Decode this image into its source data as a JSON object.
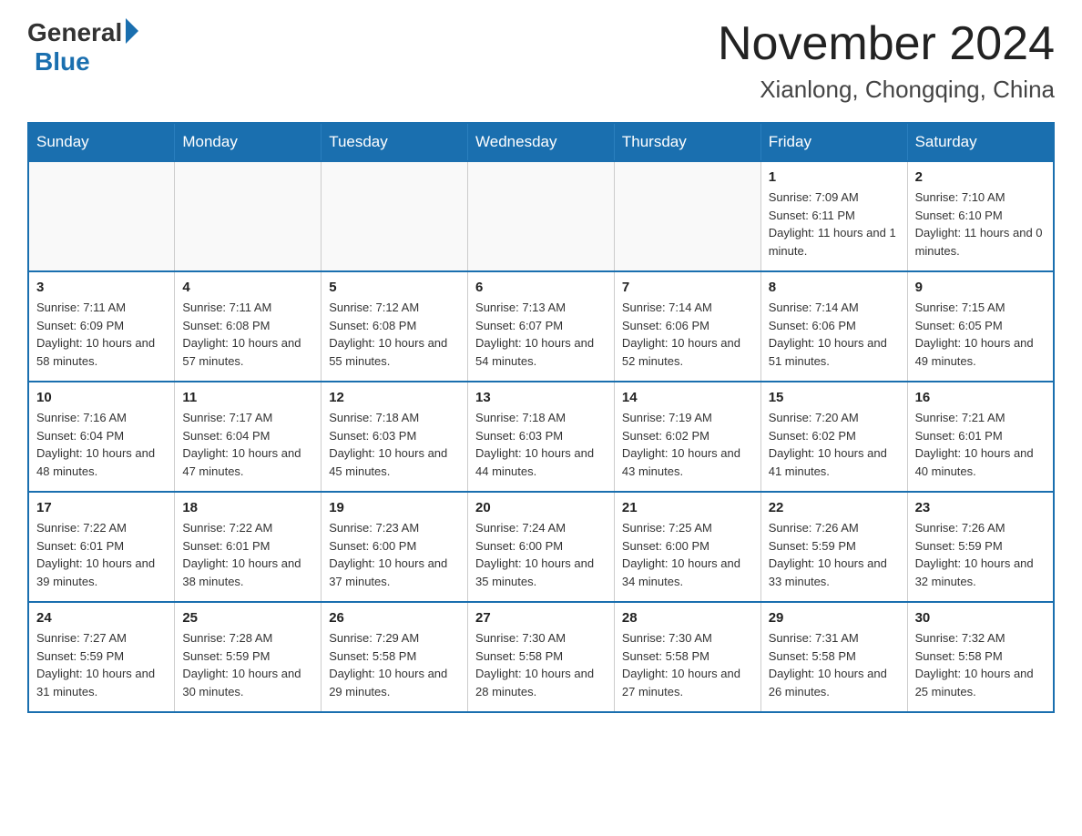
{
  "logo": {
    "general": "General",
    "blue": "Blue"
  },
  "header": {
    "month": "November 2024",
    "location": "Xianlong, Chongqing, China"
  },
  "days_of_week": [
    "Sunday",
    "Monday",
    "Tuesday",
    "Wednesday",
    "Thursday",
    "Friday",
    "Saturday"
  ],
  "weeks": [
    [
      {
        "day": "",
        "info": ""
      },
      {
        "day": "",
        "info": ""
      },
      {
        "day": "",
        "info": ""
      },
      {
        "day": "",
        "info": ""
      },
      {
        "day": "",
        "info": ""
      },
      {
        "day": "1",
        "info": "Sunrise: 7:09 AM\nSunset: 6:11 PM\nDaylight: 11 hours and 1 minute."
      },
      {
        "day": "2",
        "info": "Sunrise: 7:10 AM\nSunset: 6:10 PM\nDaylight: 11 hours and 0 minutes."
      }
    ],
    [
      {
        "day": "3",
        "info": "Sunrise: 7:11 AM\nSunset: 6:09 PM\nDaylight: 10 hours and 58 minutes."
      },
      {
        "day": "4",
        "info": "Sunrise: 7:11 AM\nSunset: 6:08 PM\nDaylight: 10 hours and 57 minutes."
      },
      {
        "day": "5",
        "info": "Sunrise: 7:12 AM\nSunset: 6:08 PM\nDaylight: 10 hours and 55 minutes."
      },
      {
        "day": "6",
        "info": "Sunrise: 7:13 AM\nSunset: 6:07 PM\nDaylight: 10 hours and 54 minutes."
      },
      {
        "day": "7",
        "info": "Sunrise: 7:14 AM\nSunset: 6:06 PM\nDaylight: 10 hours and 52 minutes."
      },
      {
        "day": "8",
        "info": "Sunrise: 7:14 AM\nSunset: 6:06 PM\nDaylight: 10 hours and 51 minutes."
      },
      {
        "day": "9",
        "info": "Sunrise: 7:15 AM\nSunset: 6:05 PM\nDaylight: 10 hours and 49 minutes."
      }
    ],
    [
      {
        "day": "10",
        "info": "Sunrise: 7:16 AM\nSunset: 6:04 PM\nDaylight: 10 hours and 48 minutes."
      },
      {
        "day": "11",
        "info": "Sunrise: 7:17 AM\nSunset: 6:04 PM\nDaylight: 10 hours and 47 minutes."
      },
      {
        "day": "12",
        "info": "Sunrise: 7:18 AM\nSunset: 6:03 PM\nDaylight: 10 hours and 45 minutes."
      },
      {
        "day": "13",
        "info": "Sunrise: 7:18 AM\nSunset: 6:03 PM\nDaylight: 10 hours and 44 minutes."
      },
      {
        "day": "14",
        "info": "Sunrise: 7:19 AM\nSunset: 6:02 PM\nDaylight: 10 hours and 43 minutes."
      },
      {
        "day": "15",
        "info": "Sunrise: 7:20 AM\nSunset: 6:02 PM\nDaylight: 10 hours and 41 minutes."
      },
      {
        "day": "16",
        "info": "Sunrise: 7:21 AM\nSunset: 6:01 PM\nDaylight: 10 hours and 40 minutes."
      }
    ],
    [
      {
        "day": "17",
        "info": "Sunrise: 7:22 AM\nSunset: 6:01 PM\nDaylight: 10 hours and 39 minutes."
      },
      {
        "day": "18",
        "info": "Sunrise: 7:22 AM\nSunset: 6:01 PM\nDaylight: 10 hours and 38 minutes."
      },
      {
        "day": "19",
        "info": "Sunrise: 7:23 AM\nSunset: 6:00 PM\nDaylight: 10 hours and 37 minutes."
      },
      {
        "day": "20",
        "info": "Sunrise: 7:24 AM\nSunset: 6:00 PM\nDaylight: 10 hours and 35 minutes."
      },
      {
        "day": "21",
        "info": "Sunrise: 7:25 AM\nSunset: 6:00 PM\nDaylight: 10 hours and 34 minutes."
      },
      {
        "day": "22",
        "info": "Sunrise: 7:26 AM\nSunset: 5:59 PM\nDaylight: 10 hours and 33 minutes."
      },
      {
        "day": "23",
        "info": "Sunrise: 7:26 AM\nSunset: 5:59 PM\nDaylight: 10 hours and 32 minutes."
      }
    ],
    [
      {
        "day": "24",
        "info": "Sunrise: 7:27 AM\nSunset: 5:59 PM\nDaylight: 10 hours and 31 minutes."
      },
      {
        "day": "25",
        "info": "Sunrise: 7:28 AM\nSunset: 5:59 PM\nDaylight: 10 hours and 30 minutes."
      },
      {
        "day": "26",
        "info": "Sunrise: 7:29 AM\nSunset: 5:58 PM\nDaylight: 10 hours and 29 minutes."
      },
      {
        "day": "27",
        "info": "Sunrise: 7:30 AM\nSunset: 5:58 PM\nDaylight: 10 hours and 28 minutes."
      },
      {
        "day": "28",
        "info": "Sunrise: 7:30 AM\nSunset: 5:58 PM\nDaylight: 10 hours and 27 minutes."
      },
      {
        "day": "29",
        "info": "Sunrise: 7:31 AM\nSunset: 5:58 PM\nDaylight: 10 hours and 26 minutes."
      },
      {
        "day": "30",
        "info": "Sunrise: 7:32 AM\nSunset: 5:58 PM\nDaylight: 10 hours and 25 minutes."
      }
    ]
  ]
}
